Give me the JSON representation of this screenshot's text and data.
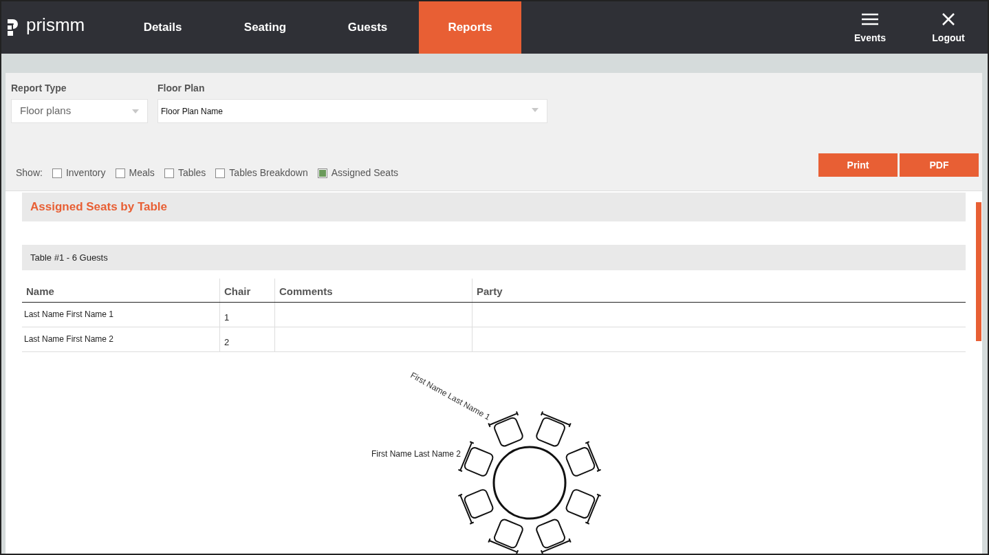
{
  "nav": {
    "logo": "prismm",
    "tabs": [
      {
        "label": "Details",
        "selected": false
      },
      {
        "label": "Seating",
        "selected": false
      },
      {
        "label": "Guests",
        "selected": false
      },
      {
        "label": "Reports",
        "selected": true
      }
    ],
    "actions": [
      {
        "kind": "menu",
        "label": "Events"
      },
      {
        "kind": "close",
        "label": "Logout"
      }
    ]
  },
  "filters": {
    "report_type": {
      "label": "Report Type",
      "value": "Floor plans"
    },
    "floor_plan": {
      "label": "Floor Plan",
      "value": "Floor Plan Name"
    },
    "show_label": "Show:",
    "show": [
      {
        "label": "Inventory",
        "checked": false
      },
      {
        "label": "Meals",
        "checked": false
      },
      {
        "label": "Tables",
        "checked": false
      },
      {
        "label": "Tables Breakdown",
        "checked": false
      },
      {
        "label": "Assigned Seats",
        "checked": true
      }
    ],
    "buttons": [
      "Print",
      "PDF"
    ]
  },
  "report": {
    "title": "Assigned Seats by Table",
    "table_heading": "Table #1 - 6 Guests",
    "columns": [
      "Name",
      "Chair",
      "Comments",
      "Party"
    ],
    "rows": [
      [
        "Last Name First Name 1",
        "1",
        "",
        ""
      ],
      [
        "Last Name First Name 2",
        "2",
        "",
        ""
      ]
    ],
    "seat_labels": [
      "First Name Last Name 1",
      "First Name Last Name 2"
    ]
  }
}
